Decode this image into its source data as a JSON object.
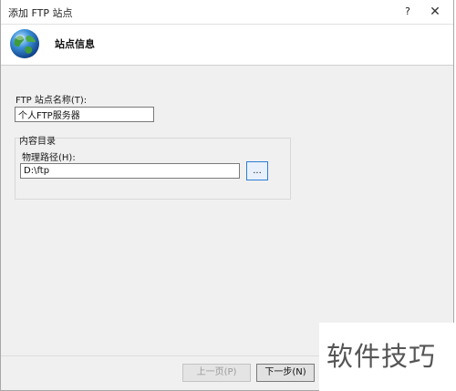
{
  "window": {
    "title": "添加 FTP 站点",
    "help_label": "?",
    "close_label": "✕"
  },
  "header": {
    "title": "站点信息",
    "icon": "globe-icon"
  },
  "form": {
    "site_name_label": "FTP 站点名称(T):",
    "site_name_value": "个人FTP服务器",
    "content_dir_label": "内容目录",
    "physical_path_label": "物理路径(H):",
    "physical_path_value": "D:\\ftp",
    "browse_label": "..."
  },
  "footer": {
    "prev_label": "上一页(P)",
    "next_label": "下一步(N)"
  },
  "watermark": {
    "text": "软件技巧"
  },
  "colors": {
    "accent": "#2c7cd6",
    "dialog_bg": "#f0f0f0"
  }
}
